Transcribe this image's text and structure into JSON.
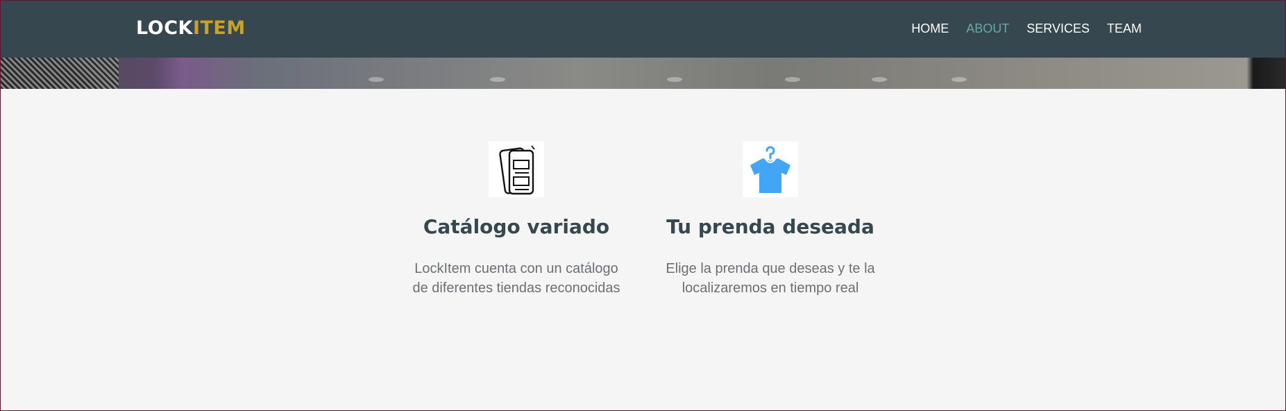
{
  "brand": {
    "part1": "LOCK",
    "part2": "ITEM",
    "color_primary": "#ffffff",
    "color_accent": "#c9a227"
  },
  "nav": {
    "items": [
      {
        "label": "HOME",
        "active": false
      },
      {
        "label": "ABOUT",
        "active": true
      },
      {
        "label": "SERVICES",
        "active": false
      },
      {
        "label": "TEAM",
        "active": false
      }
    ],
    "active_color": "#6aa6a6"
  },
  "features": [
    {
      "icon": "catalog-icon",
      "title": "Catálogo variado",
      "line1": "LockItem cuenta con un catálogo",
      "line2": "de diferentes tiendas reconocidas"
    },
    {
      "icon": "shirt-icon",
      "title": "Tu prenda deseada",
      "line1": "Elige la prenda que deseas y te la",
      "line2": "localizaremos en tiempo real"
    }
  ],
  "colors": {
    "header_bg": "#37474f",
    "page_bg": "#f5f5f5",
    "shirt_icon": "#42a5f5"
  }
}
